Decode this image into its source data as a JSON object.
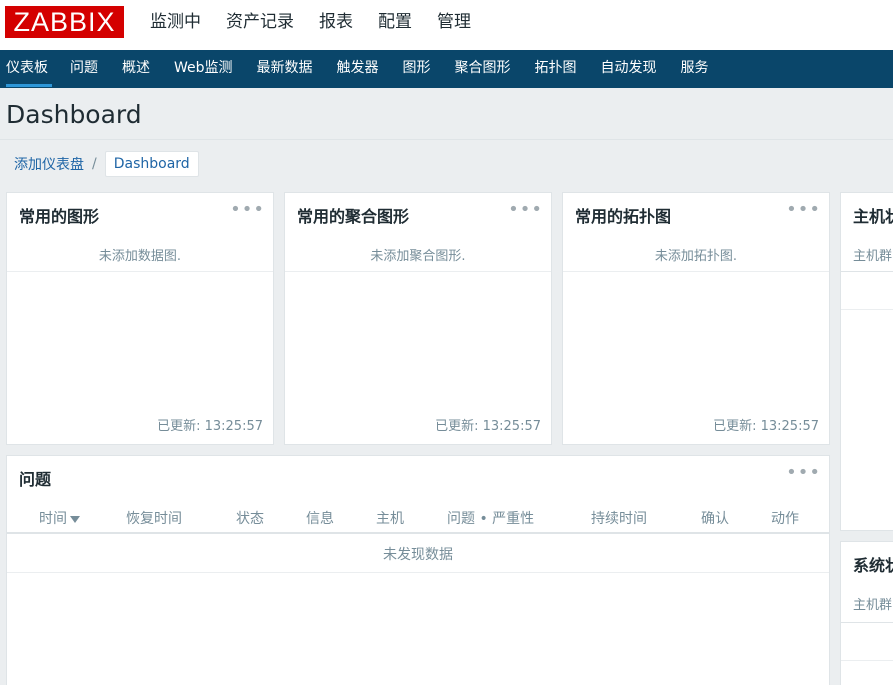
{
  "logo": "ZABBIX",
  "main_nav": [
    "监测中",
    "资产记录",
    "报表",
    "配置",
    "管理"
  ],
  "sub_nav": [
    "仪表板",
    "问题",
    "概述",
    "Web监测",
    "最新数据",
    "触发器",
    "图形",
    "聚合图形",
    "拓扑图",
    "自动发现",
    "服务"
  ],
  "page": {
    "title": "Dashboard",
    "breadcrumb_link": "添加仪表盘",
    "breadcrumb_sep": "/",
    "breadcrumb_current": "Dashboard"
  },
  "widgets": {
    "graphs": {
      "title": "常用的图形",
      "empty": "未添加数据图.",
      "updated": "已更新: 13:25:57"
    },
    "screens": {
      "title": "常用的聚合图形",
      "empty": "未添加聚合图形.",
      "updated": "已更新: 13:25:57"
    },
    "maps": {
      "title": "常用的拓扑图",
      "empty": "未添加拓扑图.",
      "updated": "已更新: 13:25:57"
    },
    "menu_glyph": "•••",
    "problems": {
      "title": "问题",
      "columns": [
        "时间",
        "恢复时间",
        "状态",
        "信息",
        "主机",
        "问题 • 严重性",
        "持续时间",
        "确认",
        "动作"
      ],
      "empty": "未发现数据"
    },
    "host_status": {
      "title": "主机状",
      "sub": "主机群"
    },
    "system_status": {
      "title": "系统状",
      "sub": "主机群"
    }
  }
}
